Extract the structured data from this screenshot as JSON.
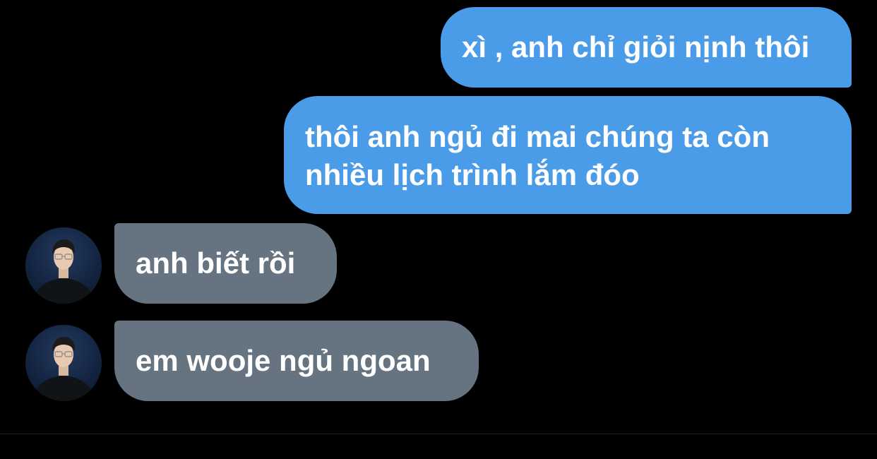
{
  "messages": [
    {
      "direction": "outgoing",
      "text": "xì , anh chỉ giỏi nịnh thôi"
    },
    {
      "direction": "outgoing",
      "text": "thôi anh ngủ đi mai chúng ta còn nhiều lịch trình lắm đóo"
    },
    {
      "direction": "incoming",
      "text": "anh biết rồi"
    },
    {
      "direction": "incoming",
      "text": "em wooje ngủ ngoan"
    }
  ],
  "colors": {
    "background": "#000000",
    "outgoing_bubble": "#4a9be8",
    "incoming_bubble": "#667482",
    "text": "#ffffff"
  },
  "icons": {
    "avatar": "contact-avatar-photo"
  }
}
